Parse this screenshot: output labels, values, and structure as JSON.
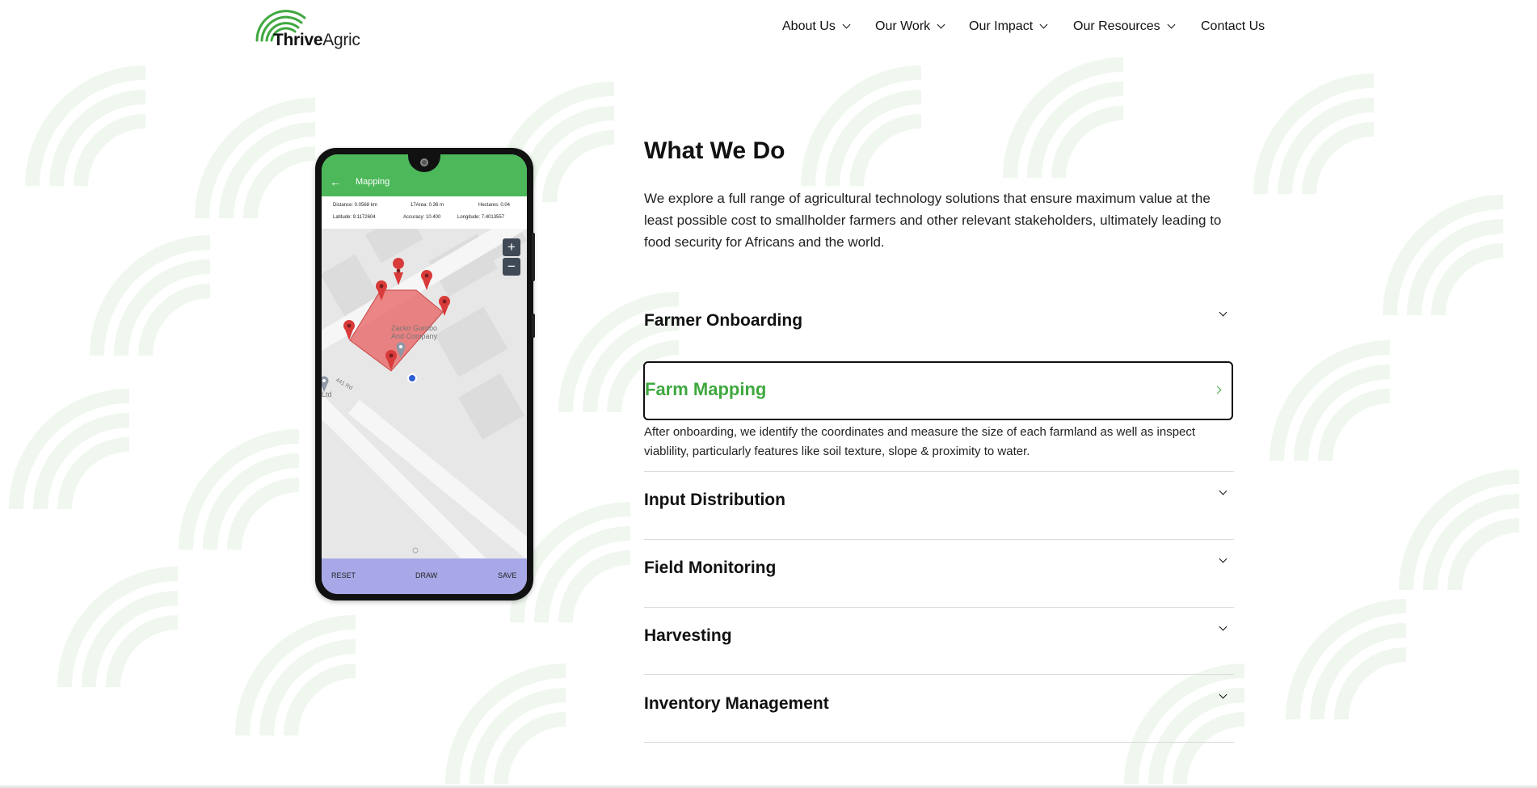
{
  "brand": {
    "name_bold": "Thrive",
    "name_regular": "Agric",
    "logo_color": "#3fa83f"
  },
  "nav": {
    "items": [
      {
        "label": "About Us",
        "has_dropdown": true
      },
      {
        "label": "Our Work",
        "has_dropdown": true
      },
      {
        "label": "Our Impact",
        "has_dropdown": true
      },
      {
        "label": "Our Resources",
        "has_dropdown": true
      },
      {
        "label": "Contact Us",
        "has_dropdown": false
      }
    ]
  },
  "phone": {
    "app_title": "Mapping",
    "info": {
      "distance": "Distance: 0.0568 km",
      "area": "17Area: 0.36 m",
      "hectares": "Hectares: 0.04",
      "latitude": "Latitude: 9.1172604",
      "accuracy": "Accuracy: 10.400",
      "longitude": "Longitude: 7.4013557"
    },
    "map_labels": {
      "company_line1": "Zacko Gurobo",
      "company_line2": "And Company",
      "road": "441 Rd",
      "ltd": "Ltd"
    },
    "zoom_in": "+",
    "zoom_out": "−",
    "bottom": {
      "reset": "RESET",
      "draw": "DRAW",
      "save": "SAVE"
    },
    "colors": {
      "app_bar": "#4cb85a",
      "bottom_bar": "#a8a8e8",
      "polygon": "#e85f5f"
    }
  },
  "section": {
    "title": "What We Do",
    "intro": "We explore a full range of agricultural technology solutions that ensure maximum value at the least possible cost to smallholder farmers and other relevant stakeholders, ultimately leading to food security for Africans and the world."
  },
  "accordion": {
    "items": [
      {
        "title": "Farmer Onboarding",
        "expanded": false
      },
      {
        "title": "Farm Mapping",
        "expanded": true,
        "description": "After onboarding, we identify the coordinates and measure the size of each farmland as well as inspect viablility, particularly features like soil texture, slope & proximity to water."
      },
      {
        "title": "Input Distribution",
        "expanded": false
      },
      {
        "title": "Field Monitoring",
        "expanded": false
      },
      {
        "title": "Harvesting",
        "expanded": false
      },
      {
        "title": "Inventory Management",
        "expanded": false
      }
    ],
    "active_color": "#3fa83f"
  }
}
